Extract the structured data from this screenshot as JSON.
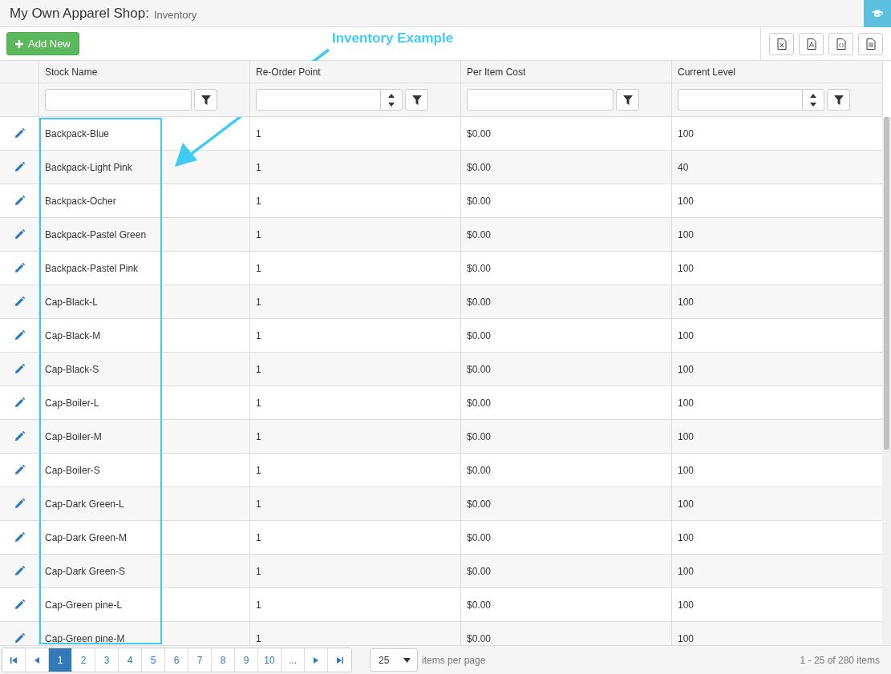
{
  "header": {
    "title": "My Own Apparel Shop:",
    "subtitle": "Inventory"
  },
  "toolbar": {
    "add_button": "Add New"
  },
  "annotation": {
    "label": "Inventory Example"
  },
  "table": {
    "columns": [
      {
        "label": "Stock Name",
        "kind": "text"
      },
      {
        "label": "Re-Order Point",
        "kind": "number"
      },
      {
        "label": "Per Item Cost",
        "kind": "text"
      },
      {
        "label": "Current Level",
        "kind": "number"
      }
    ],
    "rows": [
      [
        "Backpack-Blue",
        "1",
        "$0.00",
        "100"
      ],
      [
        "Backpack-Light Pink",
        "1",
        "$0.00",
        "40"
      ],
      [
        "Backpack-Ocher",
        "1",
        "$0.00",
        "100"
      ],
      [
        "Backpack-Pastel Green",
        "1",
        "$0.00",
        "100"
      ],
      [
        "Backpack-Pastel Pink",
        "1",
        "$0.00",
        "100"
      ],
      [
        "Cap-Black-L",
        "1",
        "$0.00",
        "100"
      ],
      [
        "Cap-Black-M",
        "1",
        "$0.00",
        "100"
      ],
      [
        "Cap-Black-S",
        "1",
        "$0.00",
        "100"
      ],
      [
        "Cap-Boiler-L",
        "1",
        "$0.00",
        "100"
      ],
      [
        "Cap-Boiler-M",
        "1",
        "$0.00",
        "100"
      ],
      [
        "Cap-Boiler-S",
        "1",
        "$0.00",
        "100"
      ],
      [
        "Cap-Dark Green-L",
        "1",
        "$0.00",
        "100"
      ],
      [
        "Cap-Dark Green-M",
        "1",
        "$0.00",
        "100"
      ],
      [
        "Cap-Dark Green-S",
        "1",
        "$0.00",
        "100"
      ],
      [
        "Cap-Green pine-L",
        "1",
        "$0.00",
        "100"
      ],
      [
        "Cap-Green pine-M",
        "1",
        "$0.00",
        "100"
      ]
    ]
  },
  "pager": {
    "pages": [
      {
        "label": "1",
        "selected": true
      },
      {
        "label": "2",
        "selected": false
      },
      {
        "label": "3",
        "selected": false
      },
      {
        "label": "4",
        "selected": false
      },
      {
        "label": "5",
        "selected": false
      },
      {
        "label": "6",
        "selected": false
      },
      {
        "label": "7",
        "selected": false
      },
      {
        "label": "8",
        "selected": false
      },
      {
        "label": "9",
        "selected": false
      },
      {
        "label": "10",
        "selected": false
      },
      {
        "label": "...",
        "selected": false
      }
    ],
    "page_size": "25",
    "page_size_label": "items per page",
    "summary": "1 - 25 of 280 items"
  }
}
